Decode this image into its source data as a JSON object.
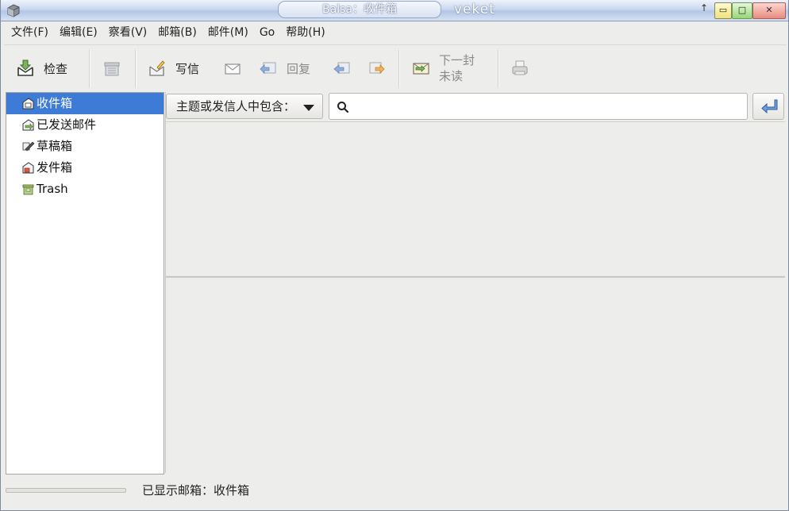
{
  "window": {
    "title": "Balsa：收件箱",
    "desktop_label": "veket",
    "controls": {
      "minimize": "▭",
      "maximize": "□",
      "close": "✕",
      "roll_up": "↑"
    }
  },
  "menu": [
    "文件(F)",
    "编辑(E)",
    "察看(V)",
    "邮箱(B)",
    "邮件(M)",
    "Go",
    "帮助(H)"
  ],
  "toolbar": {
    "check": "检查",
    "compose": "写信",
    "reply": "回复",
    "next_unread_line1": "下一封",
    "next_unread_line2": "未读"
  },
  "folders": [
    {
      "label": "收件箱",
      "icon": "inbox-icon",
      "selected": true
    },
    {
      "label": "已发送邮件",
      "icon": "sent-icon",
      "selected": false
    },
    {
      "label": "草稿箱",
      "icon": "drafts-icon",
      "selected": false
    },
    {
      "label": "发件箱",
      "icon": "outbox-icon",
      "selected": false
    },
    {
      "label": "Trash",
      "icon": "trash-icon",
      "selected": false
    }
  ],
  "filter": {
    "selected": "主题或发信人中包含：",
    "search_value": "",
    "search_placeholder": ""
  },
  "status": {
    "text": "已显示邮箱：收件箱",
    "progress": 0
  },
  "colors": {
    "selection": "#3d7bd6",
    "window_bg": "#ededeb",
    "titlebar": "#c9d7ee"
  }
}
